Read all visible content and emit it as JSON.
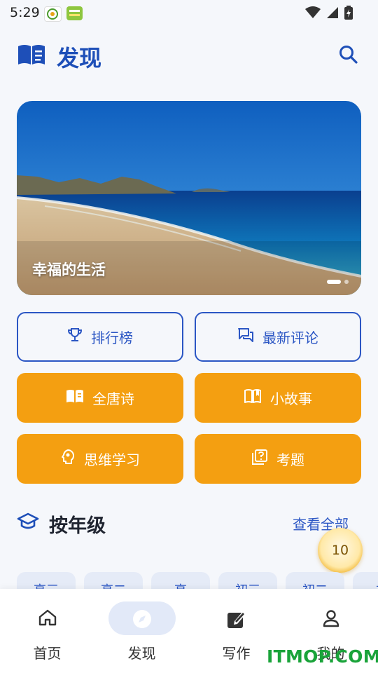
{
  "status_bar": {
    "time": "5:29"
  },
  "header": {
    "title": "发现"
  },
  "banner": {
    "caption": "幸福的生活"
  },
  "quick_actions": [
    {
      "label": "排行榜",
      "icon": "trophy-icon",
      "style": "outline"
    },
    {
      "label": "最新评论",
      "icon": "chat-icon",
      "style": "outline"
    },
    {
      "label": "全唐诗",
      "icon": "book-icon",
      "style": "fill"
    },
    {
      "label": "小故事",
      "icon": "open-book-icon",
      "style": "fill"
    },
    {
      "label": "思维学习",
      "icon": "brain-icon",
      "style": "fill"
    },
    {
      "label": "考题",
      "icon": "quiz-icon",
      "style": "fill"
    }
  ],
  "section": {
    "title": "按年级",
    "more": "查看全部"
  },
  "grade_chips": [
    "高三",
    "高二",
    "高",
    "初三",
    "初二",
    "初"
  ],
  "coin": {
    "value": "10"
  },
  "tabs": [
    {
      "label": "首页",
      "icon": "home-icon",
      "active": false
    },
    {
      "label": "发现",
      "icon": "compass-icon",
      "active": true
    },
    {
      "label": "写作",
      "icon": "edit-icon",
      "active": false
    },
    {
      "label": "我的",
      "icon": "user-icon",
      "active": false
    }
  ],
  "watermark": "ITMOP.COM",
  "colors": {
    "primary": "#1e4fb8",
    "accent": "#f49f11",
    "background": "#f5f7fb"
  }
}
